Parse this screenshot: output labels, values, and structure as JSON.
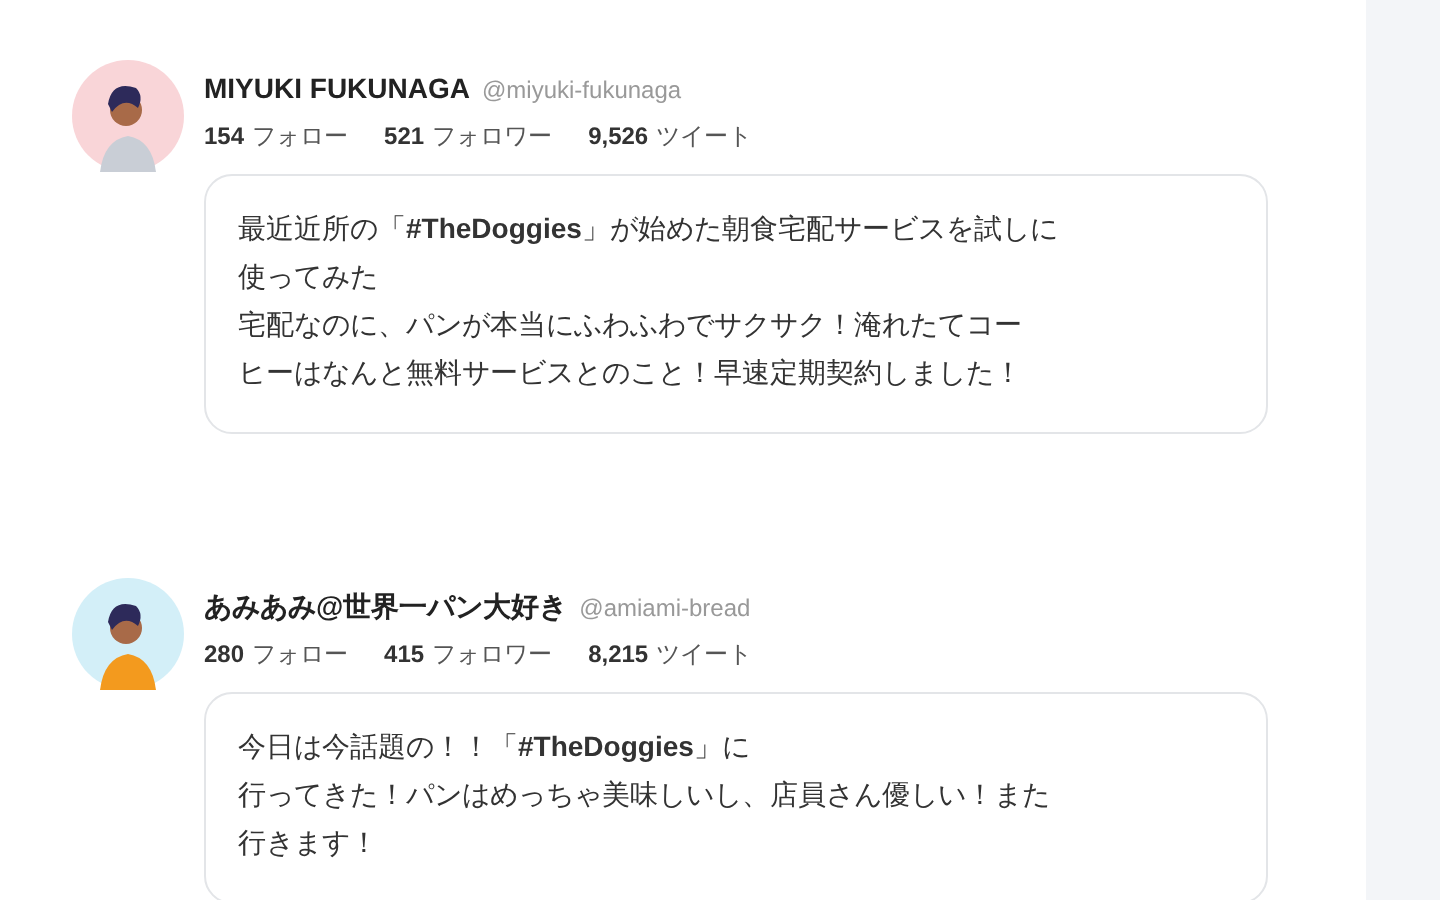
{
  "posts": [
    {
      "name": "MIYUKI FUKUNAGA",
      "handle": "@miyuki-fukunaga",
      "color": "#f9d5d8",
      "stats": [
        {
          "count": "154",
          "label": "フォロー"
        },
        {
          "count": "521",
          "label": "フォロワー"
        },
        {
          "count": "9,526",
          "label": "ツイート"
        }
      ],
      "lines": [
        "最近近所の「**#TheDoggies**」が始めた朝食宅配サービスを試しに",
        "使ってみた",
        "宅配なのに、パンが本当にふわふわでサクサク！淹れたてコー",
        "ヒーはなんと無料サービスとのこと！早速定期契約しました！"
      ]
    },
    {
      "name": "あみあみ@世界一パン大好き",
      "handle": "@amiami-bread",
      "color": "#d3eff8",
      "stats": [
        {
          "count": "280",
          "label": "フォロー"
        },
        {
          "count": "415",
          "label": "フォロワー"
        },
        {
          "count": "8,215",
          "label": "ツイート"
        }
      ],
      "lines": [
        "今日は今話題の！！「**#TheDoggies**」に",
        "行ってきた！パンはめっちゃ美味しいし、店員さん優しい！また",
        "行きます！"
      ]
    }
  ]
}
